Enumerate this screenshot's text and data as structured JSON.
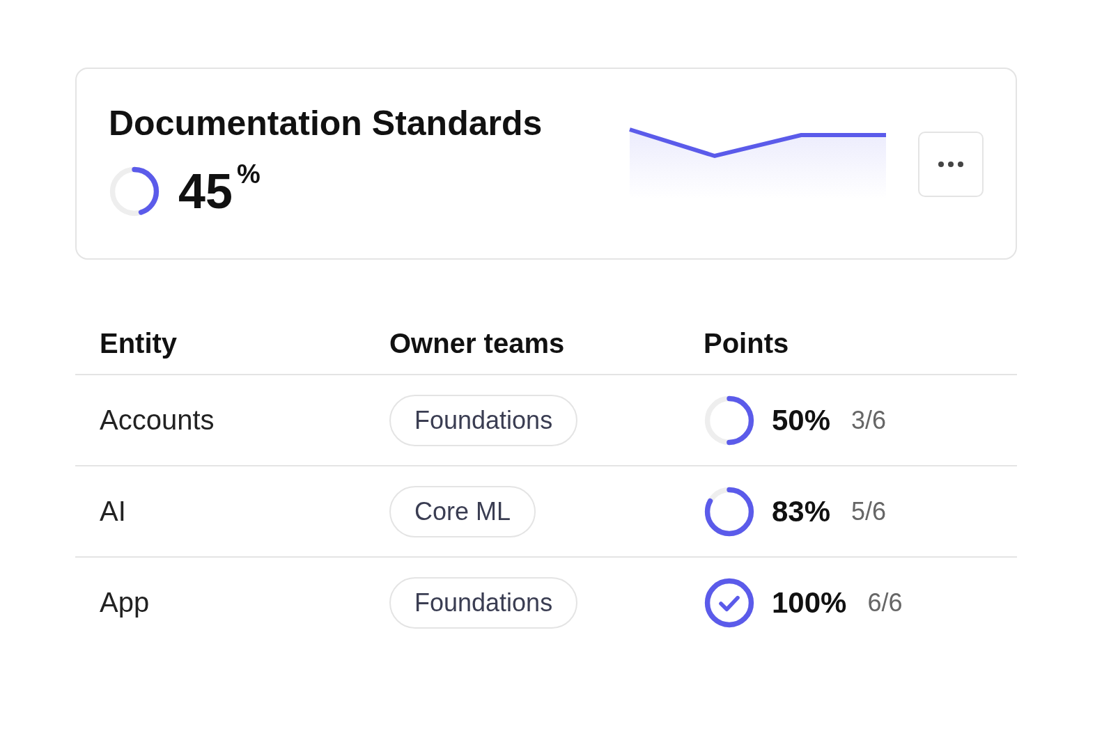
{
  "card": {
    "title": "Documentation Standards",
    "level": 0.45,
    "value": "45",
    "unit": "%"
  },
  "table": {
    "columns": [
      "Entity",
      "Owner teams",
      "Points"
    ],
    "rows": [
      {
        "entity": "Accounts",
        "team": "Foundations",
        "level": 0.5,
        "percent": "50%",
        "score": "3/6"
      },
      {
        "entity": "AI",
        "team": "Core ML",
        "level": 0.83,
        "percent": "83%",
        "score": "5/6"
      },
      {
        "entity": "App",
        "team": "Foundations",
        "level": 1,
        "percent": "100%",
        "score": "6/6"
      }
    ]
  }
}
